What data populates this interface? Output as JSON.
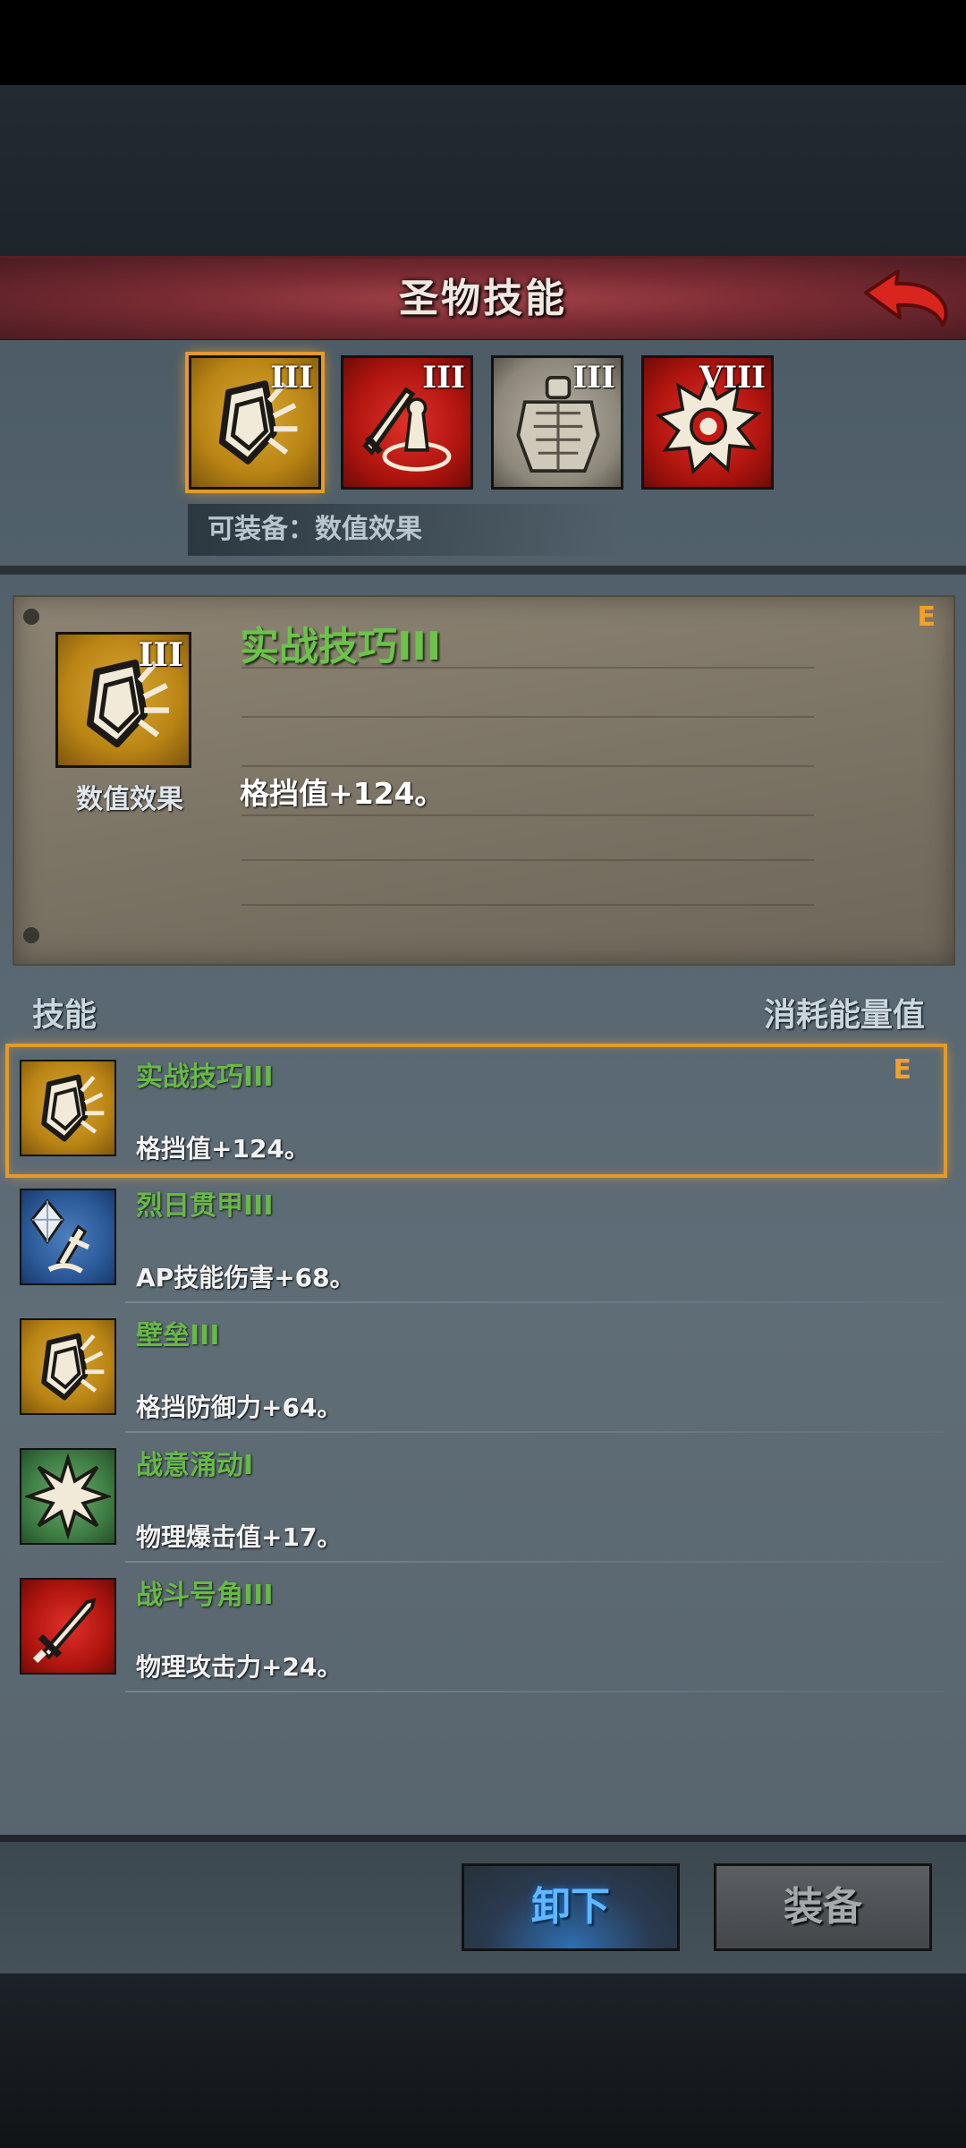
{
  "title": "圣物技能",
  "relic_tabs": [
    {
      "roman": "III",
      "icon": "shield-fracture-icon",
      "bg": "gold"
    },
    {
      "roman": "III",
      "icon": "sword-knight-icon",
      "bg": "red"
    },
    {
      "roman": "III",
      "icon": "armor-icon",
      "bg": "gray"
    },
    {
      "roman": "VIII",
      "icon": "sun-burst-icon",
      "bg": "red"
    }
  ],
  "equip_label": "可装备：数值效果",
  "detail": {
    "name": "实战技巧III",
    "roman": "III",
    "grade": "E",
    "type": "数值效果",
    "effect": "格挡值+124。"
  },
  "list_header": {
    "skill": "技能",
    "cost": "消耗能量值"
  },
  "skills": [
    {
      "name": "实战技巧III",
      "desc": "格挡值+124。",
      "grade": "E",
      "icon": "shield-fracture-icon"
    },
    {
      "name": "烈日贯甲III",
      "desc": "AP技能伤害+68。",
      "grade": "",
      "icon": "crystal-sword-icon"
    },
    {
      "name": "壁垒III",
      "desc": "格挡防御力+64。",
      "grade": "",
      "icon": "shield-fracture-icon"
    },
    {
      "name": "战意涌动I",
      "desc": "物理爆击值+17。",
      "grade": "",
      "icon": "burst-star-icon"
    },
    {
      "name": "战斗号角III",
      "desc": "物理攻击力+24。",
      "grade": "",
      "icon": "sword-icon"
    }
  ],
  "buttons": {
    "unequip": "卸下",
    "equip": "装备"
  },
  "colors": {
    "accent_orange": "#e39a2a",
    "skill_name_green": "#68b84a",
    "banner_red": "#7a2b33"
  }
}
